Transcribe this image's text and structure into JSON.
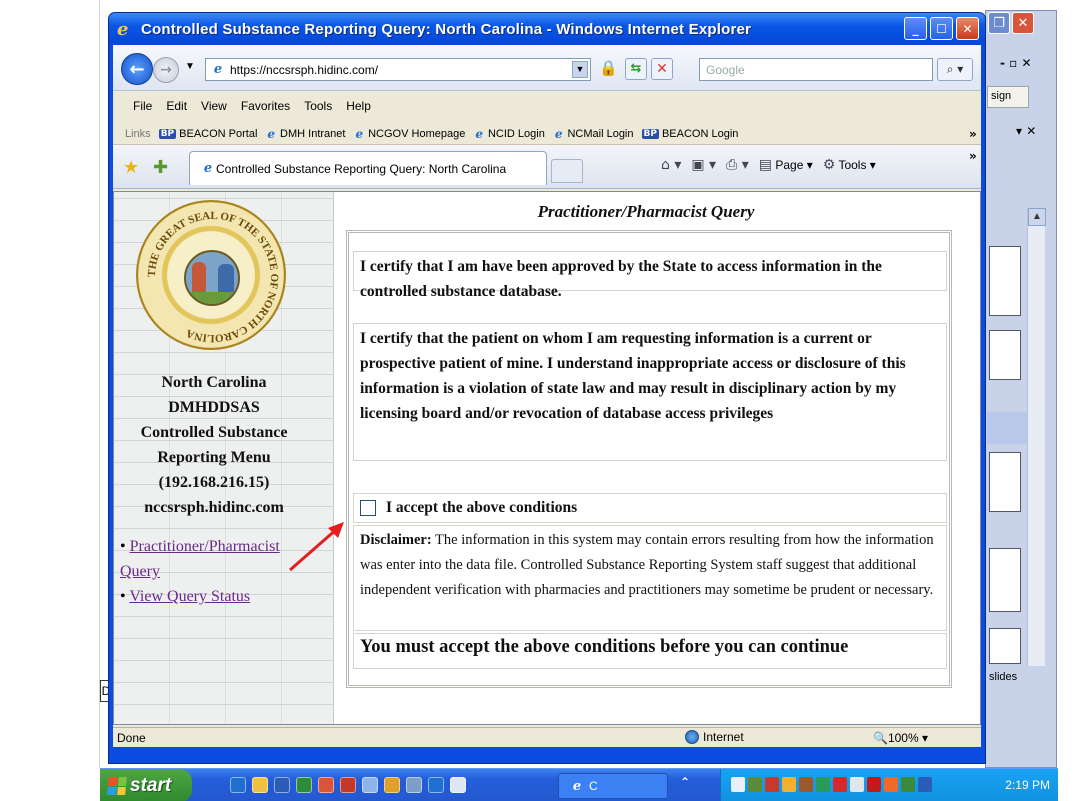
{
  "window": {
    "title": "Controlled Substance Reporting Query: North Carolina - Windows Internet Explorer"
  },
  "address_bar": {
    "url": "https://nccsrsph.hidinc.com/",
    "search_placeholder": "Google"
  },
  "menu": [
    "File",
    "Edit",
    "View",
    "Favorites",
    "Tools",
    "Help"
  ],
  "links_bar": {
    "label": "Links",
    "items": [
      "BEACON Portal",
      "DMH Intranet",
      "NCGOV Homepage",
      "NCID Login",
      "NCMail Login",
      "BEACON Login"
    ]
  },
  "tab": {
    "title": "Controlled Substance Reporting Query: North Carolina"
  },
  "toolbar": {
    "page_label": "Page",
    "tools_label": "Tools"
  },
  "sidebar": {
    "lines": [
      "North Carolina",
      "DMHDDSAS",
      "Controlled Substance",
      "Reporting Menu",
      "(192.168.216.15)",
      "nccsrsph.hidinc.com"
    ],
    "links": [
      "Practitioner/Pharmacist Query",
      "View Query Status"
    ],
    "seal_text": "THE GREAT SEAL OF THE STATE OF NORTH CAROLINA"
  },
  "main": {
    "title": "Practitioner/Pharmacist Query",
    "cert1": "I certify that I am have been approved by the State to access information in the controlled substance database.",
    "cert2": "I certify that the patient on whom I am requesting information is a current or prospective patient of mine. I understand inappropriate access or disclosure of this information is a violation of state law and may result in disciplinary action by my licensing board and/or revocation of database access privileges",
    "accept_label": "I accept the above conditions",
    "accept_checked": false,
    "disclaimer_label": "Disclaimer:",
    "disclaimer_text": " The information in this system may contain errors resulting from how the information was enter into the data file. Controlled Substance Reporting System staff suggest that additional independent verification with pharmacies and practitioners may sometime be prudent or necessary.",
    "must_accept": "You must accept the above conditions before you can continue"
  },
  "status_bar": {
    "status": "Done",
    "zone": "Internet",
    "zoom": "100%"
  },
  "background_app": {
    "sign_text": "sign",
    "slides_label": "slides",
    "d_label": "D"
  },
  "taskbar": {
    "start_label": "start",
    "task_label": "C",
    "clock": "2:19 PM"
  }
}
